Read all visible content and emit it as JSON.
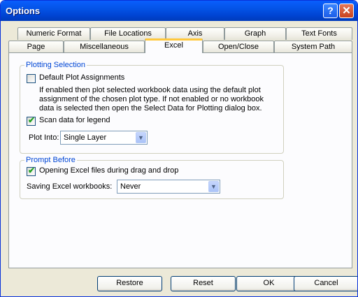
{
  "window": {
    "title": "Options"
  },
  "title_buttons": {
    "help": "?",
    "close": "✕"
  },
  "tabs_row1": [
    "Numeric Format",
    "File Locations",
    "Axis",
    "Graph",
    "Text Fonts"
  ],
  "tabs_row2": [
    "Page",
    "Miscellaneous",
    "Excel",
    "Open/Close",
    "System Path"
  ],
  "active_tab": "Excel",
  "plotting": {
    "legend": "Plotting Selection",
    "default_plot_label": "Default Plot Assignments",
    "default_plot_checked": false,
    "desc1": "If enabled then plot selected workbook data using the default plot",
    "desc2": "assignment of the chosen plot type.  If not enabled or no workbook",
    "desc3": "data is selected then open the Select Data for Plotting dialog box.",
    "scan_label": "Scan data for legend",
    "scan_checked": true,
    "plot_into_label": "Plot Into:",
    "plot_into_value": "Single Layer"
  },
  "prompt": {
    "legend": "Prompt Before",
    "opening_label": "Opening Excel files during drag and drop",
    "opening_checked": true,
    "saving_label": "Saving Excel workbooks:",
    "saving_value": "Never"
  },
  "buttons": {
    "restore": "Restore",
    "reset": "Reset",
    "ok": "OK",
    "cancel": "Cancel"
  },
  "colors": {
    "title_blue": "#0453e6",
    "tab_highlight": "#ffc83c",
    "group_text": "#0046d5",
    "check_green": "#21a121"
  }
}
